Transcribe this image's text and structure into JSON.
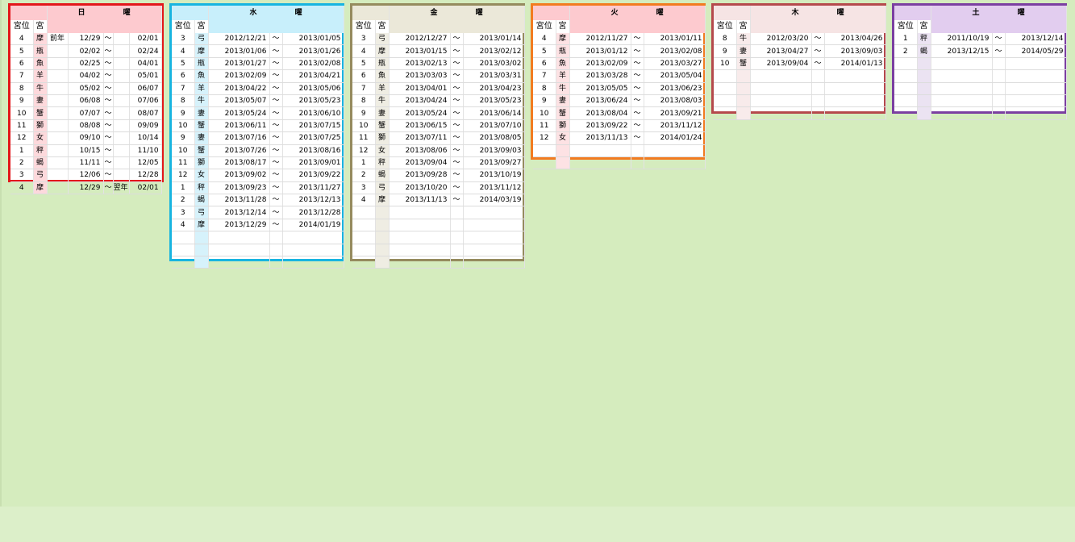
{
  "column_headers": {
    "rank": "宮位",
    "sign": "宮"
  },
  "tilde": "〜",
  "panels": [
    {
      "title": "日 曜",
      "colors": {
        "border": "#e3171b",
        "header": "#fdcacf",
        "tint": "#fdd9dc"
      },
      "rows": [
        [
          "4",
          "摩",
          "前年",
          "12/29",
          "〜",
          "",
          "02/01"
        ],
        [
          "5",
          "瓶",
          "",
          "02/02",
          "〜",
          "",
          "02/24"
        ],
        [
          "6",
          "魚",
          "",
          "02/25",
          "〜",
          "",
          "04/01"
        ],
        [
          "7",
          "羊",
          "",
          "04/02",
          "〜",
          "",
          "05/01"
        ],
        [
          "8",
          "牛",
          "",
          "05/02",
          "〜",
          "",
          "06/07"
        ],
        [
          "9",
          "妻",
          "",
          "06/08",
          "〜",
          "",
          "07/06"
        ],
        [
          "10",
          "蟹",
          "",
          "07/07",
          "〜",
          "",
          "08/07"
        ],
        [
          "11",
          "獅",
          "",
          "08/08",
          "〜",
          "",
          "09/09"
        ],
        [
          "12",
          "女",
          "",
          "09/10",
          "〜",
          "",
          "10/14"
        ],
        [
          "1",
          "秤",
          "",
          "10/15",
          "〜",
          "",
          "11/10"
        ],
        [
          "2",
          "蝎",
          "",
          "11/11",
          "〜",
          "",
          "12/05"
        ],
        [
          "3",
          "弓",
          "",
          "12/06",
          "〜",
          "",
          "12/28"
        ],
        [
          "4",
          "摩",
          "",
          "12/29",
          "〜",
          "翌年",
          "02/01"
        ]
      ]
    },
    {
      "title": "水 曜",
      "colors": {
        "border": "#18b4e0",
        "header": "#c8effb",
        "tint": "#d6f2fb"
      },
      "rows": [
        [
          "3",
          "弓",
          "2012/12/21",
          "〜",
          "2013/01/05"
        ],
        [
          "4",
          "摩",
          "2013/01/06",
          "〜",
          "2013/01/26"
        ],
        [
          "5",
          "瓶",
          "2013/01/27",
          "〜",
          "2013/02/08"
        ],
        [
          "6",
          "魚",
          "2013/02/09",
          "〜",
          "2013/04/21"
        ],
        [
          "7",
          "羊",
          "2013/04/22",
          "〜",
          "2013/05/06"
        ],
        [
          "8",
          "牛",
          "2013/05/07",
          "〜",
          "2013/05/23"
        ],
        [
          "9",
          "妻",
          "2013/05/24",
          "〜",
          "2013/06/10"
        ],
        [
          "10",
          "蟹",
          "2013/06/11",
          "〜",
          "2013/07/15"
        ],
        [
          "9",
          "妻",
          "2013/07/16",
          "〜",
          "2013/07/25"
        ],
        [
          "10",
          "蟹",
          "2013/07/26",
          "〜",
          "2013/08/16"
        ],
        [
          "11",
          "獅",
          "2013/08/17",
          "〜",
          "2013/09/01"
        ],
        [
          "12",
          "女",
          "2013/09/02",
          "〜",
          "2013/09/22"
        ],
        [
          "1",
          "秤",
          "2013/09/23",
          "〜",
          "2013/11/27"
        ],
        [
          "2",
          "蝎",
          "2013/11/28",
          "〜",
          "2013/12/13"
        ],
        [
          "3",
          "弓",
          "2013/12/14",
          "〜",
          "2013/12/28"
        ],
        [
          "4",
          "摩",
          "2013/12/29",
          "〜",
          "2014/01/19"
        ],
        [
          "",
          "",
          "",
          "",
          ""
        ],
        [
          "",
          "",
          "",
          "",
          ""
        ],
        [
          "",
          "",
          "",
          "",
          ""
        ]
      ]
    },
    {
      "title": "金 曜",
      "colors": {
        "border": "#958b5e",
        "header": "#ebe8d9",
        "tint": "#efede3"
      },
      "rows": [
        [
          "3",
          "弓",
          "2012/12/27",
          "〜",
          "2013/01/14"
        ],
        [
          "4",
          "摩",
          "2013/01/15",
          "〜",
          "2013/02/12"
        ],
        [
          "5",
          "瓶",
          "2013/02/13",
          "〜",
          "2013/03/02"
        ],
        [
          "6",
          "魚",
          "2013/03/03",
          "〜",
          "2013/03/31"
        ],
        [
          "7",
          "羊",
          "2013/04/01",
          "〜",
          "2013/04/23"
        ],
        [
          "8",
          "牛",
          "2013/04/24",
          "〜",
          "2013/05/23"
        ],
        [
          "9",
          "妻",
          "2013/05/24",
          "〜",
          "2013/06/14"
        ],
        [
          "10",
          "蟹",
          "2013/06/15",
          "〜",
          "2013/07/10"
        ],
        [
          "11",
          "獅",
          "2013/07/11",
          "〜",
          "2013/08/05"
        ],
        [
          "12",
          "女",
          "2013/08/06",
          "〜",
          "2013/09/03"
        ],
        [
          "1",
          "秤",
          "2013/09/04",
          "〜",
          "2013/09/27"
        ],
        [
          "2",
          "蝎",
          "2013/09/28",
          "〜",
          "2013/10/19"
        ],
        [
          "3",
          "弓",
          "2013/10/20",
          "〜",
          "2013/11/12"
        ],
        [
          "4",
          "摩",
          "2013/11/13",
          "〜",
          "2014/03/19"
        ],
        [
          "",
          "",
          "",
          "",
          ""
        ],
        [
          "",
          "",
          "",
          "",
          ""
        ],
        [
          "",
          "",
          "",
          "",
          ""
        ],
        [
          "",
          "",
          "",
          "",
          ""
        ],
        [
          "",
          "",
          "",
          "",
          ""
        ]
      ]
    },
    {
      "title": "火 曜",
      "colors": {
        "border": "#f27b20",
        "header": "#fdcacf",
        "tint": "#fde2e4"
      },
      "rows": [
        [
          "4",
          "摩",
          "2012/11/27",
          "〜",
          "2013/01/11"
        ],
        [
          "5",
          "瓶",
          "2013/01/12",
          "〜",
          "2013/02/08"
        ],
        [
          "6",
          "魚",
          "2013/02/09",
          "〜",
          "2013/03/27"
        ],
        [
          "7",
          "羊",
          "2013/03/28",
          "〜",
          "2013/05/04"
        ],
        [
          "8",
          "牛",
          "2013/05/05",
          "〜",
          "2013/06/23"
        ],
        [
          "9",
          "妻",
          "2013/06/24",
          "〜",
          "2013/08/03"
        ],
        [
          "10",
          "蟹",
          "2013/08/04",
          "〜",
          "2013/09/21"
        ],
        [
          "11",
          "獅",
          "2013/09/22",
          "〜",
          "2013/11/12"
        ],
        [
          "12",
          "女",
          "2013/11/13",
          "〜",
          "2014/01/24"
        ],
        [
          "",
          "",
          "",
          "",
          ""
        ],
        [
          "",
          "",
          "",
          "",
          ""
        ]
      ]
    },
    {
      "title": "木 曜",
      "colors": {
        "border": "#b5494c",
        "header": "#f6e4e4",
        "tint": "#f8ebeb"
      },
      "rows": [
        [
          "8",
          "牛",
          "2012/03/20",
          "〜",
          "2013/04/26"
        ],
        [
          "9",
          "妻",
          "2013/04/27",
          "〜",
          "2013/09/03"
        ],
        [
          "10",
          "蟹",
          "2013/09/04",
          "〜",
          "2014/01/13"
        ],
        [
          "",
          "",
          "",
          "",
          ""
        ],
        [
          "",
          "",
          "",
          "",
          ""
        ],
        [
          "",
          "",
          "",
          "",
          ""
        ],
        [
          "",
          "",
          "",
          "",
          ""
        ]
      ]
    },
    {
      "title": "土 曜",
      "colors": {
        "border": "#7b3fa1",
        "header": "#e2cdef",
        "tint": "#ebe3f2"
      },
      "rows": [
        [
          "1",
          "秤",
          "2011/10/19",
          "〜",
          "2013/12/14"
        ],
        [
          "2",
          "蝎",
          "2013/12/15",
          "〜",
          "2014/05/29"
        ],
        [
          "",
          "",
          "",
          "",
          ""
        ],
        [
          "",
          "",
          "",
          "",
          ""
        ],
        [
          "",
          "",
          "",
          "",
          ""
        ],
        [
          "",
          "",
          "",
          "",
          ""
        ],
        [
          "",
          "",
          "",
          "",
          ""
        ]
      ]
    }
  ]
}
